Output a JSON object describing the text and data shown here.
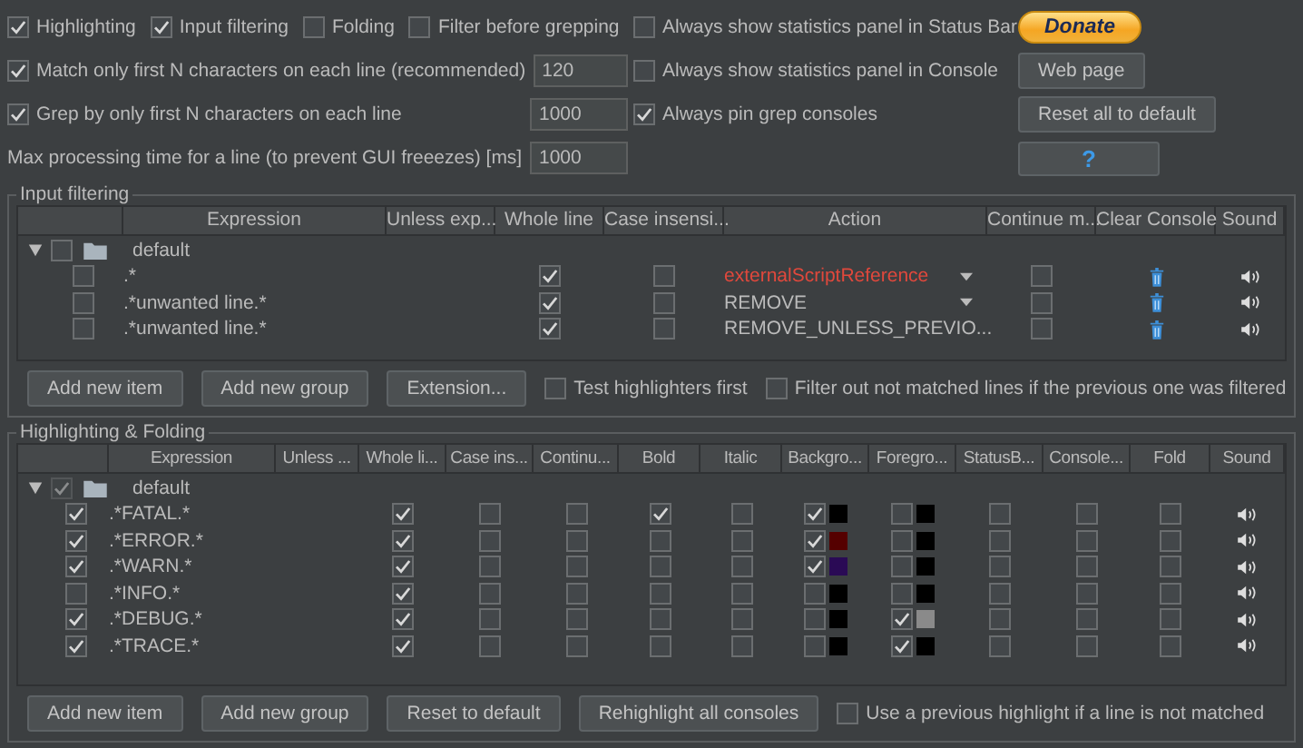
{
  "options": {
    "top_checkboxes": [
      {
        "label": "Highlighting",
        "checked": true
      },
      {
        "label": "Input filtering",
        "checked": true
      },
      {
        "label": "Folding",
        "checked": false
      },
      {
        "label": "Filter before grepping",
        "checked": false
      }
    ],
    "numeric_settings": [
      {
        "kind": "checkbox",
        "label": "Match only first N characters on each line (recommended)",
        "checked": true,
        "value": "120"
      },
      {
        "kind": "checkbox",
        "label": "Grep by only first N characters on each line",
        "checked": true,
        "value": "1000"
      },
      {
        "kind": "plain",
        "label": "Max processing time for a line (to prevent GUI freeezes) [ms]",
        "value": "1000"
      }
    ],
    "panel_checkboxes": [
      {
        "label": "Always show statistics panel in Status Bar",
        "checked": false
      },
      {
        "label": "Always show statistics panel in Console",
        "checked": false
      },
      {
        "label": "Always pin grep consoles",
        "checked": true
      }
    ],
    "buttons": [
      {
        "kind": "donate",
        "label": "Donate"
      },
      {
        "kind": "plain",
        "label": "Web page"
      },
      {
        "kind": "plain",
        "label": "Reset all to default"
      },
      {
        "kind": "help",
        "label": "?"
      }
    ]
  },
  "input_filtering": {
    "title": "Input filtering",
    "columns": [
      "Expression",
      "Unless exp...",
      "Whole line",
      "Case insensi...",
      "Action",
      "Continue m...",
      "Clear Console",
      "Sound"
    ],
    "group": {
      "name": "default",
      "expanded": true,
      "checked": false
    },
    "rows": [
      {
        "enabled": false,
        "expression": ".*",
        "whole_line": true,
        "case_insensitive": false,
        "action": "externalScriptReference",
        "color": "#e0483c",
        "continue_matching": false
      },
      {
        "enabled": false,
        "expression": ".*unwanted line.*",
        "whole_line": true,
        "case_insensitive": false,
        "action": "REMOVE",
        "color": "#bbbbbb",
        "continue_matching": false
      },
      {
        "enabled": false,
        "expression": ".*unwanted line.*",
        "whole_line": true,
        "case_insensitive": false,
        "action": "REMOVE_UNLESS_PREVIO...",
        "color": "#bbbbbb",
        "continue_matching": false
      }
    ],
    "buttons": [
      "Add new item",
      "Add new group",
      "Extension..."
    ],
    "options": [
      {
        "label": "Test highlighters first",
        "checked": false
      },
      {
        "label": "Filter out not matched lines if the previous one was filtered",
        "checked": false
      }
    ]
  },
  "highlighting": {
    "title": "Highlighting & Folding",
    "columns": [
      "Expression",
      "Unless ...",
      "Whole li...",
      "Case ins...",
      "Continu...",
      "Bold",
      "Italic",
      "Backgro...",
      "Foregro...",
      "StatusB...",
      "Console...",
      "Fold",
      "Sound"
    ],
    "group": {
      "name": "default",
      "expanded": true,
      "checked": true
    },
    "rows": [
      {
        "enabled": true,
        "expression": ".*FATAL.*",
        "whole_line": true,
        "case_insensitive": false,
        "continue_matching": false,
        "bold": true,
        "italic": false,
        "background": {
          "checked": true,
          "color": "#000000"
        },
        "foreground": {
          "checked": false,
          "color": "#000000"
        },
        "status_bar": false,
        "console": false,
        "fold": false
      },
      {
        "enabled": true,
        "expression": ".*ERROR.*",
        "whole_line": true,
        "case_insensitive": false,
        "continue_matching": false,
        "bold": false,
        "italic": false,
        "background": {
          "checked": true,
          "color": "#550000"
        },
        "foreground": {
          "checked": false,
          "color": "#000000"
        },
        "status_bar": false,
        "console": false,
        "fold": false
      },
      {
        "enabled": true,
        "expression": ".*WARN.*",
        "whole_line": true,
        "case_insensitive": false,
        "continue_matching": false,
        "bold": false,
        "italic": false,
        "background": {
          "checked": true,
          "color": "#2a0a55"
        },
        "foreground": {
          "checked": false,
          "color": "#000000"
        },
        "status_bar": false,
        "console": false,
        "fold": false
      },
      {
        "enabled": false,
        "expression": ".*INFO.*",
        "whole_line": true,
        "case_insensitive": false,
        "continue_matching": false,
        "bold": false,
        "italic": false,
        "background": {
          "checked": false,
          "color": "#000000"
        },
        "foreground": {
          "checked": false,
          "color": "#000000"
        },
        "status_bar": false,
        "console": false,
        "fold": false
      },
      {
        "enabled": true,
        "expression": ".*DEBUG.*",
        "whole_line": true,
        "case_insensitive": false,
        "continue_matching": false,
        "bold": false,
        "italic": false,
        "background": {
          "checked": false,
          "color": "#000000"
        },
        "foreground": {
          "checked": true,
          "color": "#8a8a8a"
        },
        "status_bar": false,
        "console": false,
        "fold": false
      },
      {
        "enabled": true,
        "expression": ".*TRACE.*",
        "whole_line": true,
        "case_insensitive": false,
        "continue_matching": false,
        "bold": false,
        "italic": false,
        "background": {
          "checked": false,
          "color": "#000000"
        },
        "foreground": {
          "checked": true,
          "color": "#000000"
        },
        "status_bar": false,
        "console": false,
        "fold": false
      }
    ],
    "buttons": [
      "Add new item",
      "Add new group",
      "Reset to default",
      "Rehighlight all consoles"
    ],
    "options": [
      {
        "label": "Use a previous highlight if a line is not matched",
        "checked": false
      }
    ]
  }
}
